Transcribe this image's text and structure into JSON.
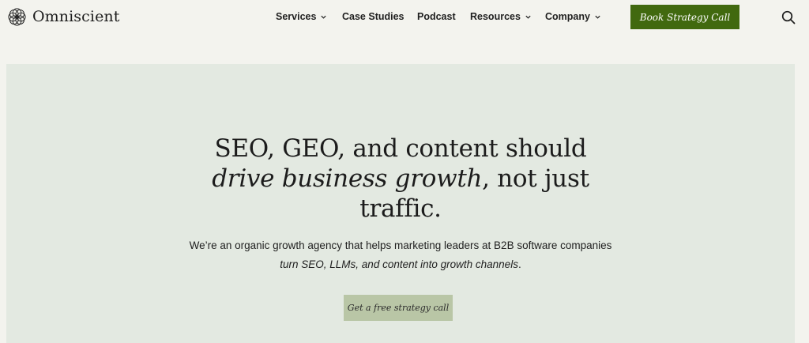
{
  "brand": {
    "name": "Omniscient",
    "logo_icon": "interlaced-circles-logo-icon"
  },
  "nav": {
    "items": [
      {
        "label": "Services",
        "has_dropdown": true
      },
      {
        "label": "Case Studies",
        "has_dropdown": false
      },
      {
        "label": "Podcast",
        "has_dropdown": false
      },
      {
        "label": "Resources",
        "has_dropdown": true
      },
      {
        "label": "Company",
        "has_dropdown": true
      }
    ],
    "cta_label": "Book Strategy Call",
    "search_icon": "search-icon"
  },
  "hero": {
    "title_line1": "SEO, GEO, and content should",
    "title_line2_italic": "drive business growth",
    "title_line2_rest": ", not just",
    "title_line3": "traffic.",
    "subtitle_line1": "We’re an organic growth agency that helps marketing leaders at B2B software companies",
    "subtitle_line2_italic": "turn SEO, LLMs, and content into growth channels",
    "subtitle_line2_rest": ".",
    "cta_label": "Get a free strategy call"
  },
  "colors": {
    "page_background": "#f3f3ee",
    "hero_background": "#e3e9e1",
    "primary_cta": "#41690f",
    "secondary_cta": "#b9c6a6"
  }
}
